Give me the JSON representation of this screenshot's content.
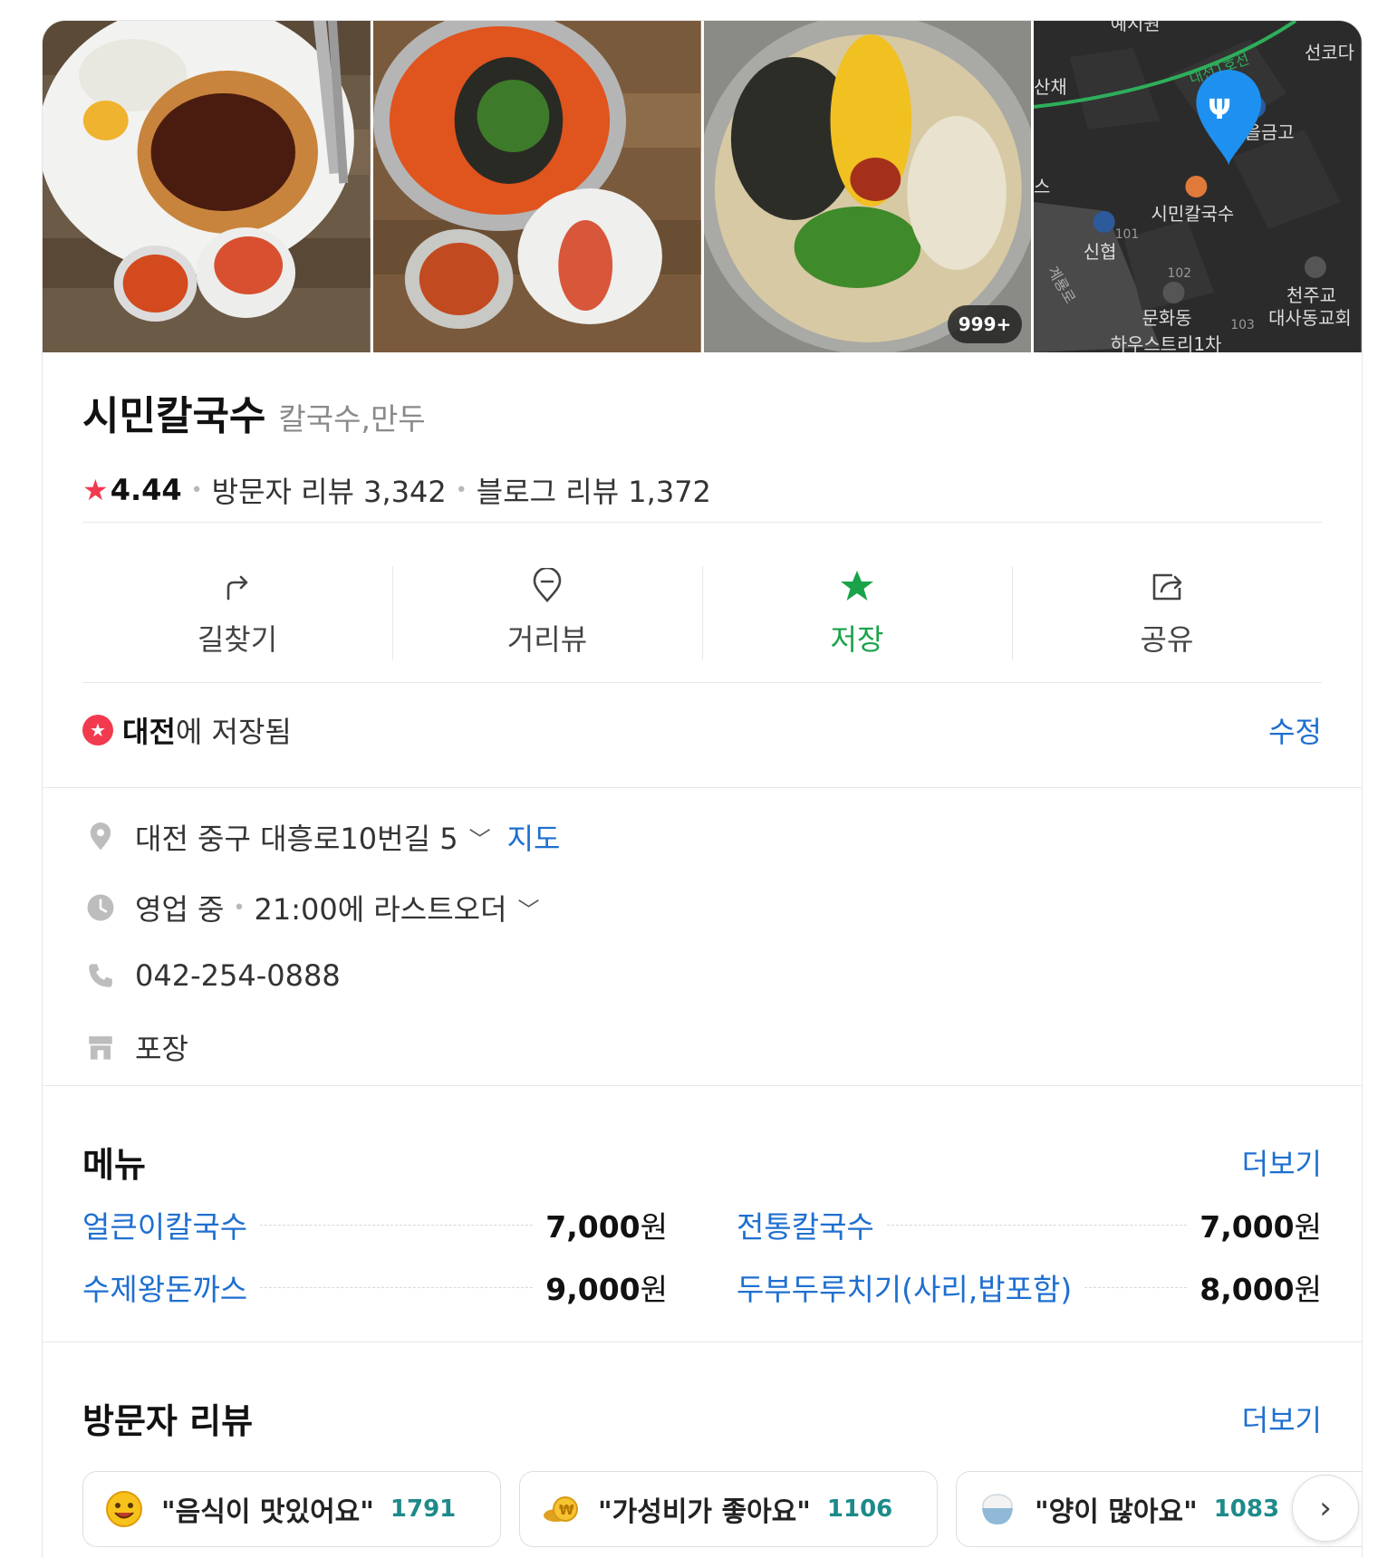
{
  "photos": {
    "count_badge": "999+",
    "map_labels": [
      "예지원",
      "선코다",
      "산채",
      "대전1호선",
      "마을금고",
      "시민칼국수",
      "스",
      "101",
      "신협",
      "102",
      "천주교",
      "대사동교회",
      "문화동",
      "103",
      "계룡로",
      "하우스트리1차"
    ]
  },
  "place": {
    "name": "시민칼국수",
    "category": "칼국수,만두",
    "rating_star": "★",
    "rating": "4.44",
    "visitor_reviews": "방문자 리뷰 3,342",
    "blog_reviews": "블로그 리뷰 1,372"
  },
  "actions": [
    {
      "label": "길찾기",
      "icon": "directions-icon"
    },
    {
      "label": "거리뷰",
      "icon": "streetview-pin-icon"
    },
    {
      "label": "저장",
      "icon": "star-icon"
    },
    {
      "label": "공유",
      "icon": "share-icon"
    }
  ],
  "saved": {
    "list_name": "대전",
    "suffix": "에 저장됨",
    "edit_label": "수정",
    "accent": "#f23a4f"
  },
  "info": {
    "address": "대전 중구 대흥로10번길 5",
    "map_link": "지도",
    "status": "영업 중",
    "hours": "21:00에 라스트오더",
    "phone": "042-254-0888",
    "service": "포장"
  },
  "menu": {
    "title": "메뉴",
    "more": "더보기",
    "items": [
      {
        "name": "얼큰이칼국수",
        "price": "7,000",
        "unit": "원"
      },
      {
        "name": "전통칼국수",
        "price": "7,000",
        "unit": "원"
      },
      {
        "name": "수제왕돈까스",
        "price": "9,000",
        "unit": "원"
      },
      {
        "name": "두부두루치기(사리,밥포함)",
        "price": "8,000",
        "unit": "원"
      }
    ]
  },
  "reviews": {
    "title": "방문자 리뷰",
    "more": "더보기",
    "chips": [
      {
        "text": "\"음식이 맛있어요\"",
        "count": "1791",
        "icon": "smiley-icon"
      },
      {
        "text": "\"가성비가 좋아요\"",
        "count": "1106",
        "icon": "coins-icon"
      },
      {
        "text": "\"양이 많아요\"",
        "count": "1083",
        "icon": "rice-bowl-icon"
      }
    ],
    "next": "›"
  },
  "colors": {
    "link": "#1e6fd0",
    "saved_green": "#1aa34a",
    "count_teal": "#1e8a8a"
  }
}
